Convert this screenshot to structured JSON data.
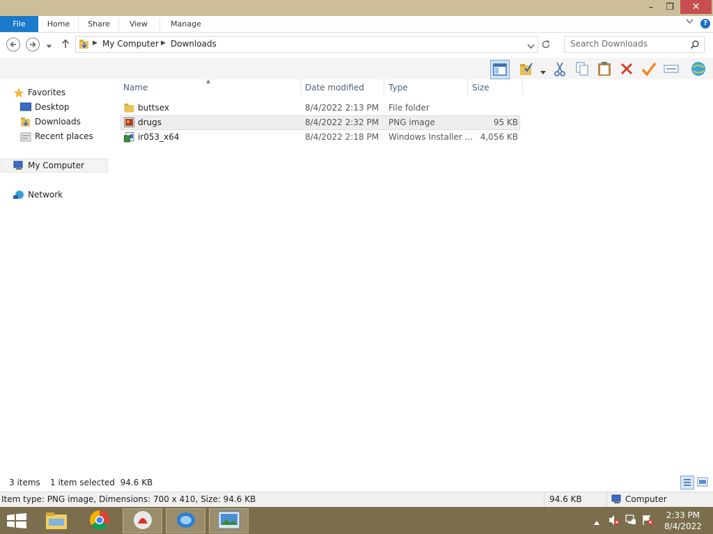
{
  "window": {
    "controls": {
      "minimize": "–",
      "maximize": "❐",
      "close": "✕"
    }
  },
  "ribbon": {
    "tabs": [
      "File",
      "Home",
      "Share",
      "View",
      "Manage"
    ],
    "help": "?"
  },
  "address": {
    "crumbs": [
      "My Computer",
      "Downloads"
    ],
    "search_placeholder": "Search Downloads"
  },
  "toolbar": {
    "icons": [
      "layout-pane-icon",
      "folder-check-icon",
      "cut-icon",
      "copy-icon",
      "paste-icon",
      "delete-icon",
      "check-icon",
      "rename-icon",
      "network-globe-icon"
    ]
  },
  "sidebar": {
    "favorites_label": "Favorites",
    "favorites": [
      "Desktop",
      "Downloads",
      "Recent places"
    ],
    "computer_label": "My Computer",
    "network_label": "Network"
  },
  "columns": {
    "name": "Name",
    "date": "Date modified",
    "type": "Type",
    "size": "Size"
  },
  "files": [
    {
      "name": "buttsex",
      "date": "8/4/2022 2:13 PM",
      "type": "File folder",
      "size": "",
      "icon": "folder-icon"
    },
    {
      "name": "drugs",
      "date": "8/4/2022 2:32 PM",
      "type": "PNG image",
      "size": "95 KB",
      "icon": "png-image-icon",
      "selected": true
    },
    {
      "name": "ir053_x64",
      "date": "8/4/2022 2:18 PM",
      "type": "Windows Installer ...",
      "size": "4,056 KB",
      "icon": "installer-icon"
    }
  ],
  "status": {
    "item_count": "3 items",
    "selection": "1 item selected  94.6 KB",
    "details": "Item type: PNG image, Dimensions: 700 x 410, Size: 94.6 KB",
    "size": "94.6 KB",
    "location": "Computer"
  },
  "taskbar": {
    "time": "2:33 PM",
    "date": "8/4/2022"
  },
  "colors": {
    "titlebar": "#cdbe9a",
    "file_tab": "#1979ca",
    "close_button": "#c74f4f",
    "taskbar": "#7b6e4e",
    "header_text": "#4c607a"
  }
}
